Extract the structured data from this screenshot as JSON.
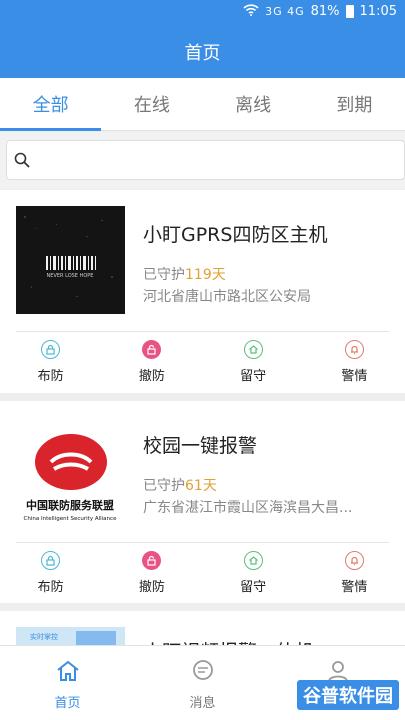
{
  "status": {
    "signal_text": "3G 4G",
    "battery": "81%",
    "time": "11:05"
  },
  "header": {
    "title": "首页"
  },
  "tabs": [
    {
      "label": "全部",
      "active": true
    },
    {
      "label": "在线",
      "active": false
    },
    {
      "label": "离线",
      "active": false
    },
    {
      "label": "到期",
      "active": false
    }
  ],
  "search": {
    "placeholder": "",
    "value": ""
  },
  "devices": [
    {
      "title": "小盯GPRS四防区主机",
      "guard_prefix": "已守护",
      "days": "119天",
      "address": "河北省唐山市路北区公安局",
      "thumb_text": "NEVER LOSE HOPE"
    },
    {
      "title": "校园一键报警",
      "guard_prefix": "已守护",
      "days": "61天",
      "address": "广东省湛江市霞山区海滨昌大昌...",
      "thumb_text": "中国联防服务联盟",
      "thumb_subtext": "China Intelligent Security Alliance"
    },
    {
      "title": "小盯视频报警一体机",
      "thumb_text": "实时掌控"
    }
  ],
  "actions": {
    "arm": "布防",
    "disarm": "撤防",
    "stay": "留守",
    "alarm": "警情"
  },
  "bottom_nav": [
    {
      "label": "首页",
      "icon": "home-icon",
      "active": true
    },
    {
      "label": "消息",
      "icon": "message-icon",
      "active": false
    },
    {
      "label": "",
      "icon": "user-icon",
      "active": false
    }
  ],
  "watermark": "谷普软件园",
  "colors": {
    "brand": "#3a8ee6",
    "days": "#e0a033"
  }
}
